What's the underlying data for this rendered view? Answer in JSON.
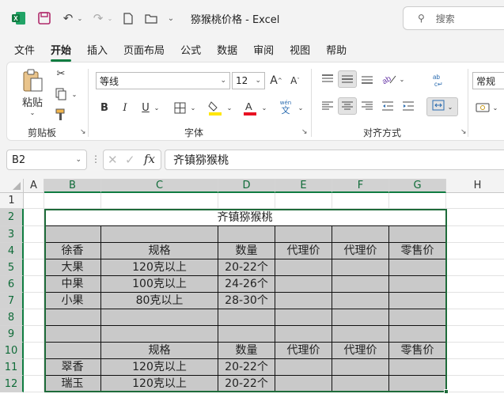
{
  "titlebar": {
    "title": "猕猴桃价格  -  Excel",
    "search_placeholder": "搜索",
    "icons": [
      "excel-logo-icon",
      "save-icon",
      "undo-icon",
      "redo-icon",
      "new-file-icon",
      "open-folder-icon",
      "customize-icon",
      "search-icon"
    ]
  },
  "tabs": [
    "文件",
    "开始",
    "插入",
    "页面布局",
    "公式",
    "数据",
    "审阅",
    "视图",
    "帮助"
  ],
  "active_tab": "开始",
  "ribbon": {
    "clipboard": {
      "paste_label": "粘贴",
      "group_label": "剪贴板"
    },
    "font": {
      "font_name": "等线",
      "font_size": "12",
      "group_label": "字体",
      "phonetic_top": "wén",
      "phonetic_bottom": "文",
      "font_color": "#e81123",
      "highlight_color": "#ffe600"
    },
    "alignment": {
      "group_label": "对齐方式"
    },
    "number": {
      "format": "常规"
    }
  },
  "formula_bar": {
    "name_box": "B2",
    "fx": "fx",
    "content": "齐镇猕猴桃"
  },
  "columns": [
    "A",
    "B",
    "C",
    "D",
    "E",
    "F",
    "G",
    "H"
  ],
  "rows": [
    "1",
    "2",
    "3",
    "4",
    "5",
    "6",
    "7",
    "8",
    "9",
    "10",
    "11",
    "12"
  ],
  "selected_cell": "B2",
  "sheet": {
    "title": "齐镇猕猴桃",
    "r3": [
      "",
      "",
      "",
      "",
      "",
      ""
    ],
    "r4": [
      "徐香",
      "规格",
      "数量",
      "代理价",
      "代理价",
      "零售价"
    ],
    "r5": [
      "大果",
      "120克以上",
      "20-22个",
      "",
      "",
      ""
    ],
    "r6": [
      "中果",
      "100克以上",
      "24-26个",
      "",
      "",
      ""
    ],
    "r7": [
      "小果",
      "80克以上",
      "28-30个",
      "",
      "",
      ""
    ],
    "r8": [
      "",
      "",
      "",
      "",
      "",
      ""
    ],
    "r9": [
      "",
      "",
      "",
      "",
      "",
      ""
    ],
    "r10": [
      "",
      "规格",
      "数量",
      "代理价",
      "代理价",
      "零售价"
    ],
    "r11": [
      "翠香",
      "120克以上",
      "20-22个",
      "",
      "",
      ""
    ],
    "r12": [
      "瑞玉",
      "120克以上",
      "20-22个",
      "",
      "",
      ""
    ]
  },
  "colors": {
    "accent": "#107c41",
    "cell_gray": "#c9c9c9"
  }
}
